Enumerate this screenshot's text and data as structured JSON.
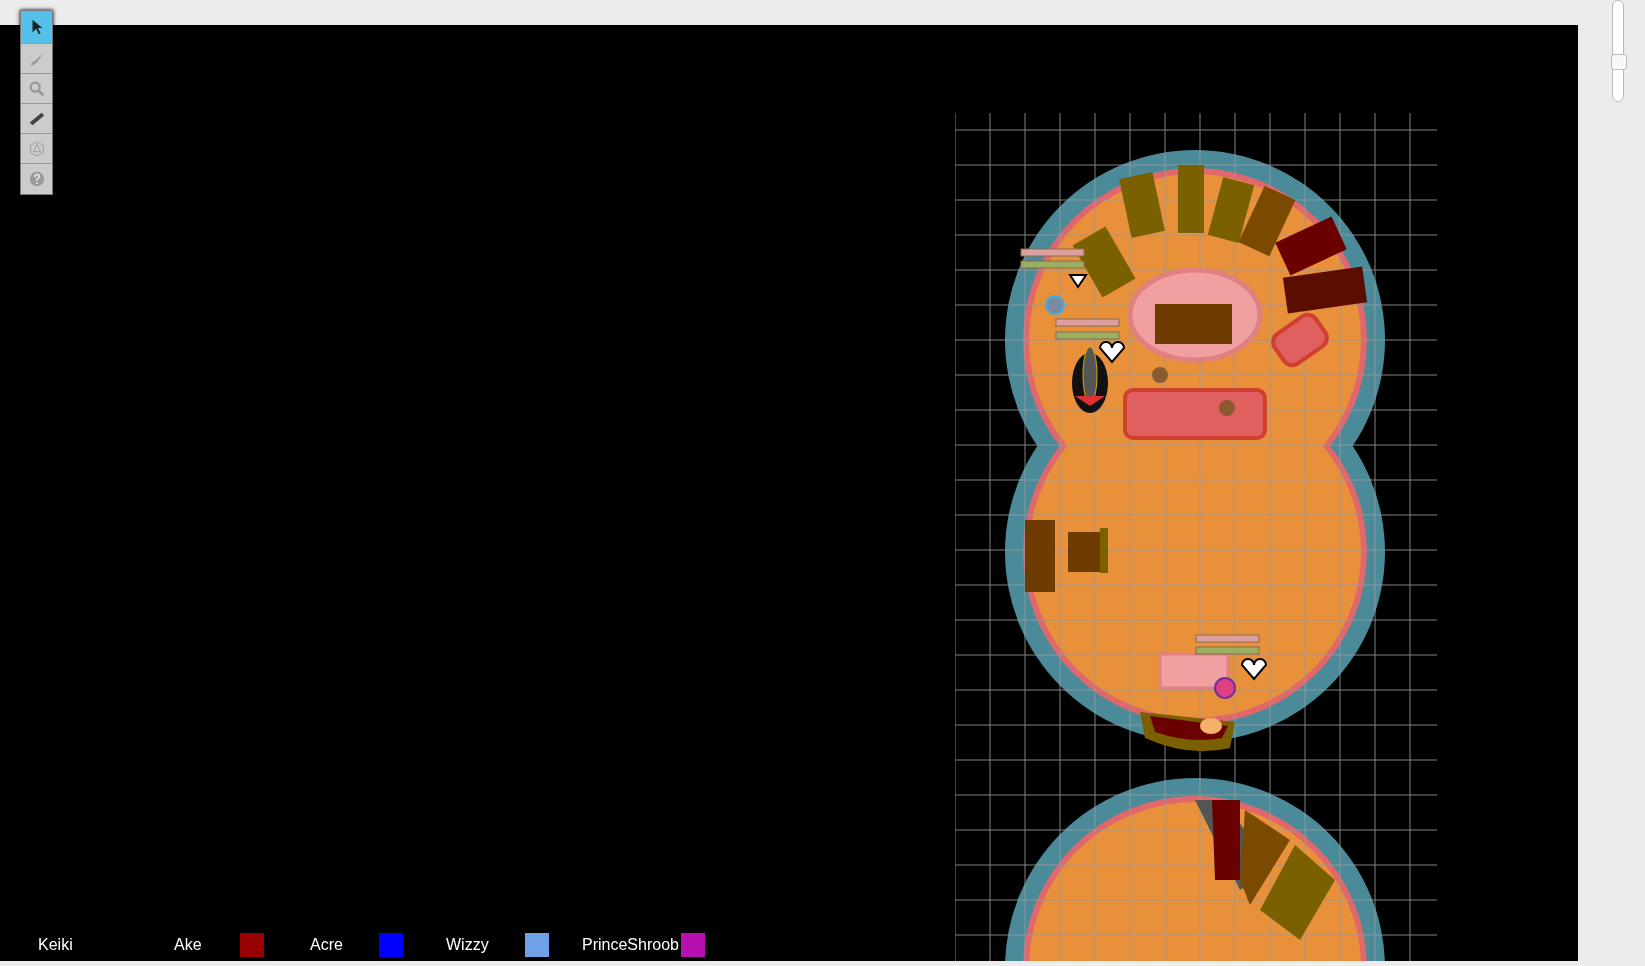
{
  "toolbar": {
    "tools": [
      {
        "kind": "pointer",
        "selected": true
      },
      {
        "kind": "brush",
        "selected": false
      },
      {
        "kind": "zoom",
        "selected": false
      },
      {
        "kind": "ruler",
        "selected": false
      },
      {
        "kind": "dice",
        "selected": false
      },
      {
        "kind": "help",
        "selected": false
      }
    ]
  },
  "zoom_slider": {
    "level": 0.4
  },
  "players": [
    {
      "name": "Keiki"
    },
    {
      "name": "Ake",
      "color": "#990000"
    },
    {
      "name": "Acre",
      "color": "#0000ff"
    },
    {
      "name": "Wizzy",
      "color": "#6fa0e8"
    },
    {
      "name": "PrinceShroob",
      "color": "#b710b0"
    }
  ]
}
